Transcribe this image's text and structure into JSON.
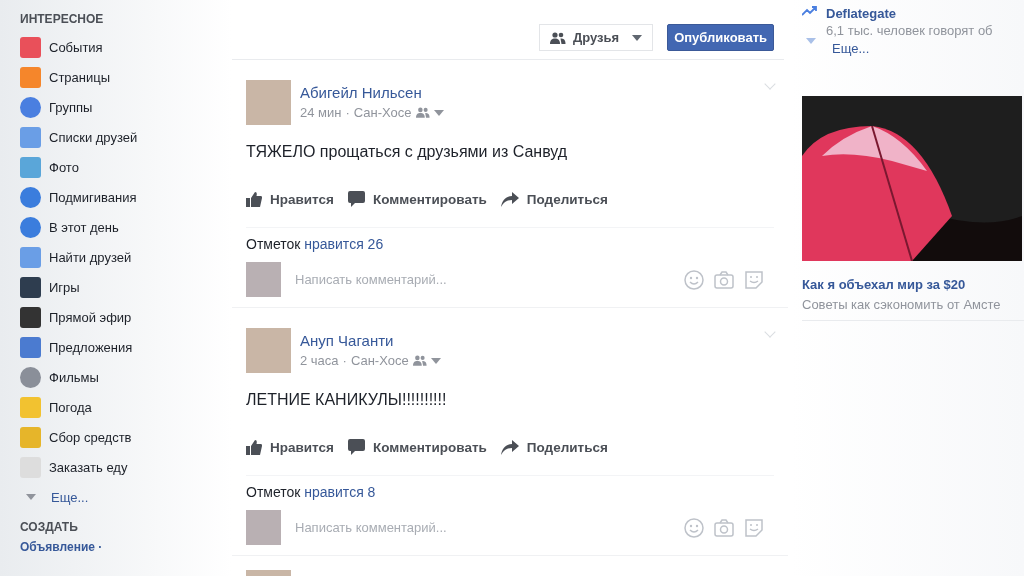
{
  "sidebar": {
    "heading": "ИНТЕРЕСНОЕ",
    "items": [
      {
        "label": "События"
      },
      {
        "label": "Страницы"
      },
      {
        "label": "Группы"
      },
      {
        "label": "Списки друзей"
      },
      {
        "label": "Фото"
      },
      {
        "label": "Подмигивания"
      },
      {
        "label": "В этот день"
      },
      {
        "label": "Найти друзей"
      },
      {
        "label": "Игры"
      },
      {
        "label": "Прямой эфир"
      },
      {
        "label": "Предложения"
      },
      {
        "label": "Фильмы"
      },
      {
        "label": "Погода"
      },
      {
        "label": "Сбор средств"
      },
      {
        "label": "Заказать еду"
      }
    ],
    "more": "Еще...",
    "create_heading": "СОЗДАТЬ",
    "create_link": "Объявление ·"
  },
  "composer": {
    "audience": "Друзья",
    "publish": "Опубликовать"
  },
  "posts": [
    {
      "author": "Абигейл Нильсен",
      "time": "24 мин",
      "separator": "·",
      "location": "Сан-Хосе",
      "text": "ТЯЖЕЛО прощаться с друзьями из Санвуд",
      "actions": [
        "Нравится",
        "Комментировать",
        "Поделиться"
      ],
      "likes_prefix": "Отметок",
      "likes": "нравится 26",
      "comment_placeholder": "Написать комментарий..."
    },
    {
      "author": "Ануп Чаганти",
      "time": "2 часа",
      "separator": "·",
      "location": "Сан-Хосе",
      "text": "ЛЕТНИЕ КАНИКУЛЫ!!!!!!!!!!",
      "actions": [
        "Нравится",
        "Комментировать",
        "Поделиться"
      ],
      "likes_prefix": "Отметок",
      "likes": "нравится 8",
      "comment_placeholder": "Написать комментарий..."
    }
  ],
  "trending": {
    "topic": "Deflategate",
    "subtitle": "6,1 тыс. человек говорят об",
    "more": "Еще..."
  },
  "ad": {
    "title": "Как я объехал мир за $20",
    "subtitle": "Советы как сэкономить от Амсте"
  }
}
